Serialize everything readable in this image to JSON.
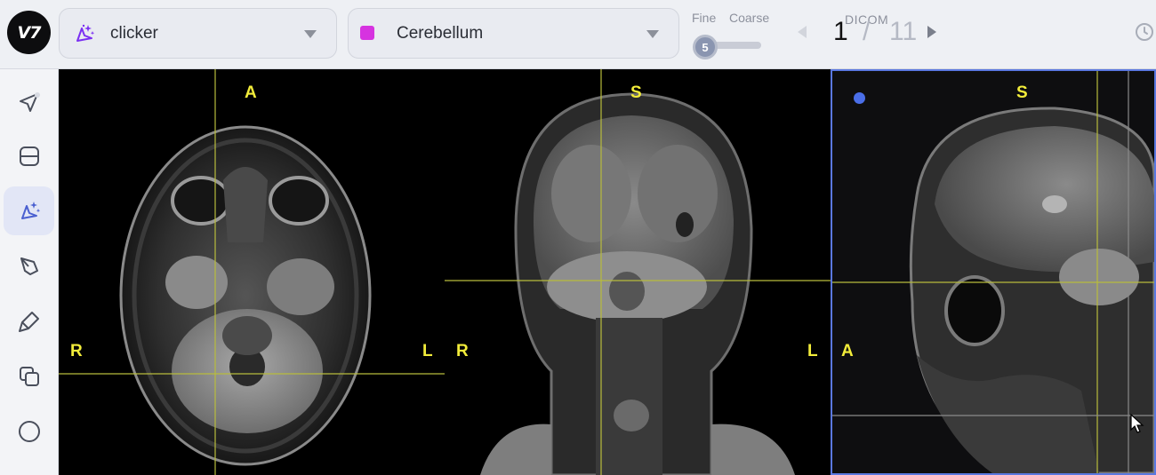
{
  "app": {
    "logo_text": "V7"
  },
  "toolbar": {
    "tool_select": {
      "value": "clicker",
      "icon": "clicker-sparkle-icon",
      "icon_color": "#7b2ff2"
    },
    "class_select": {
      "value": "Cerebellum",
      "swatch_color": "#d633e0"
    },
    "brush": {
      "fine_label": "Fine",
      "coarse_label": "Coarse",
      "value": "5"
    },
    "frame": {
      "source_label": "DICOM",
      "current": "1",
      "separator": "/",
      "total": "11"
    }
  },
  "sidebar": {
    "tools": [
      {
        "name": "navigate-tool",
        "icon": "navigation-arrow-icon"
      },
      {
        "name": "bounding-box-tool",
        "icon": "rounded-box-icon"
      },
      {
        "name": "clicker-tool",
        "icon": "clicker-sparkle-icon",
        "active": true
      },
      {
        "name": "pen-tool",
        "icon": "pen-nib-icon"
      },
      {
        "name": "brush-tool",
        "icon": "brush-icon"
      },
      {
        "name": "copy-tool",
        "icon": "layers-icon"
      },
      {
        "name": "ellipse-tool",
        "icon": "circle-icon"
      }
    ]
  },
  "viewports": {
    "axial": {
      "top": "A",
      "left": "R",
      "right": "L"
    },
    "coronal": {
      "top": "S",
      "left": "R",
      "right": "L"
    },
    "sagittal": {
      "top": "S",
      "left": "A"
    }
  },
  "colors": {
    "accent": "#5a78e0",
    "orientation_label": "#f2ec3a",
    "crosshair": "#b8bc3c"
  }
}
